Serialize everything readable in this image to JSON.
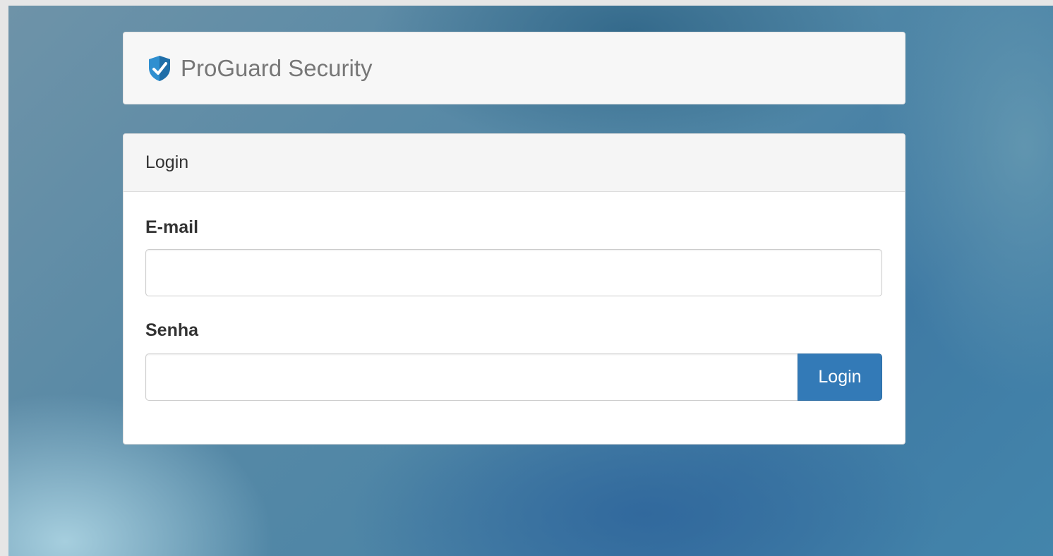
{
  "brand": {
    "name": "ProGuard Security",
    "icon": "shield-icon"
  },
  "login_panel": {
    "heading": "Login",
    "email_label": "E-mail",
    "email_value": "",
    "password_label": "Senha",
    "password_value": "",
    "submit_label": "Login"
  },
  "colors": {
    "primary": "#337ab7",
    "shield": "#2f8fd0"
  }
}
